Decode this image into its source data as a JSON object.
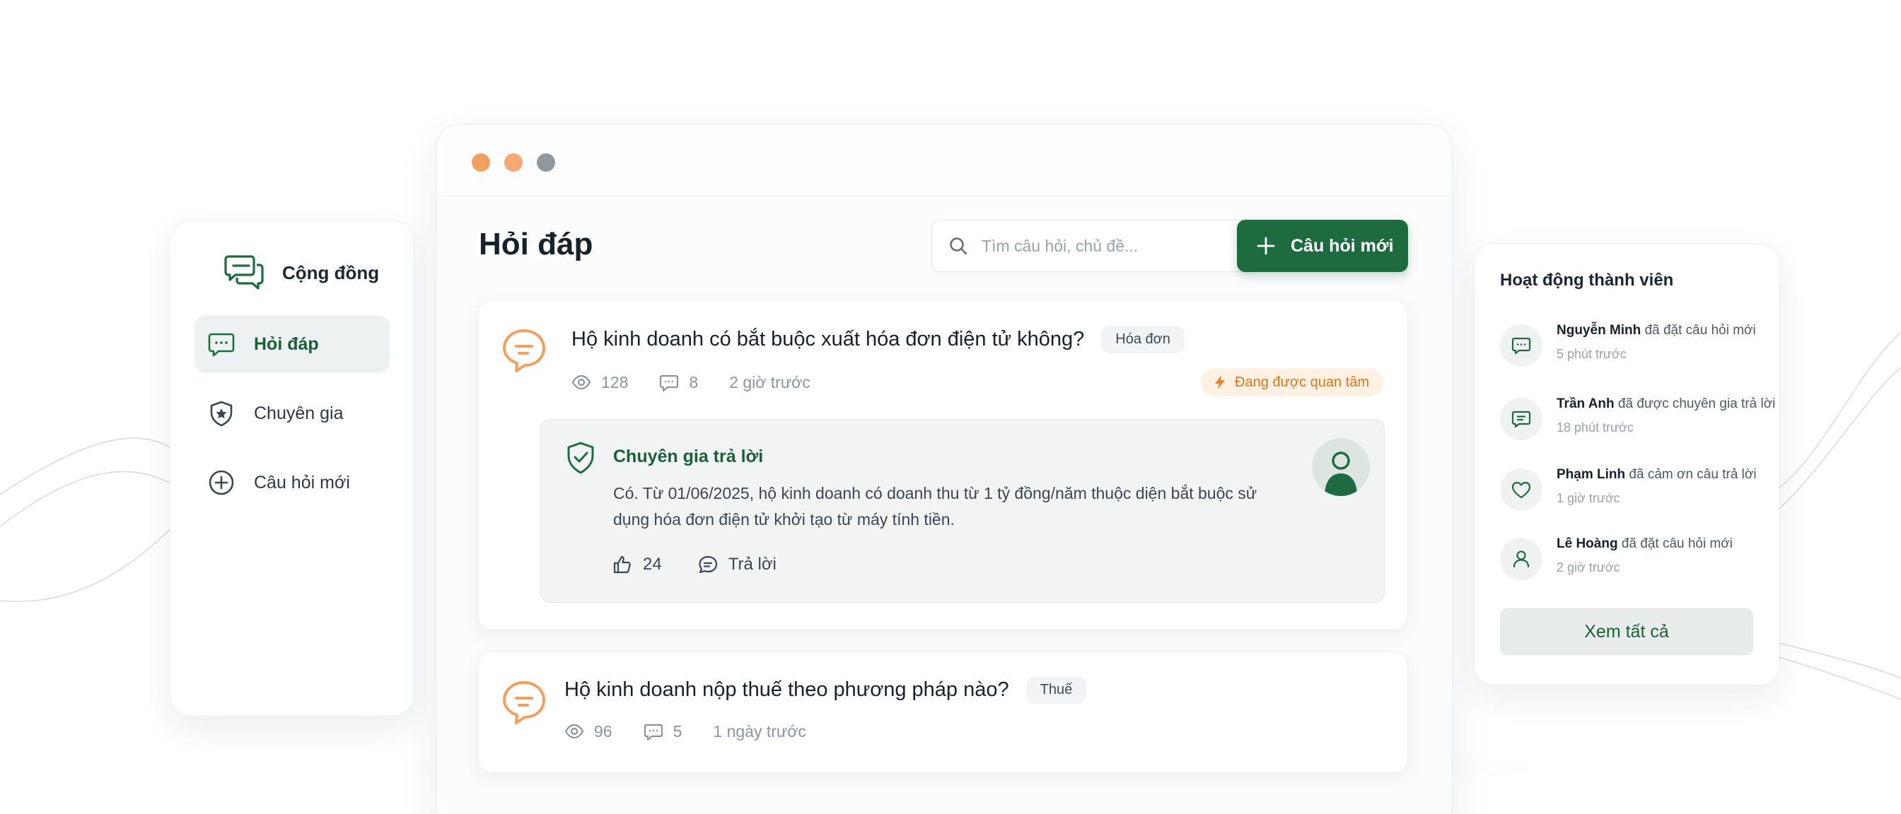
{
  "colors": {
    "brand_green": "#1e6b3f",
    "accent_orange": "#f2a061",
    "hot_orange": "#d9771f"
  },
  "sidebar": {
    "brand": {
      "name": "Cộng đồng",
      "icon": "chat-bubbles-icon"
    },
    "items": [
      {
        "label": "Hỏi đáp",
        "icon": "chat-dots-icon",
        "active": true
      },
      {
        "label": "Chuyên gia",
        "icon": "shield-star-icon",
        "active": false
      },
      {
        "label": "Câu hỏi mới",
        "icon": "plus-circle-icon",
        "active": false
      }
    ]
  },
  "main": {
    "title": "Hỏi đáp",
    "search": {
      "placeholder": "Tìm câu hỏi, chủ đề...",
      "icon": "search-icon"
    },
    "new_button": {
      "label": "Câu hỏi mới",
      "icon": "plus-icon"
    },
    "questions": [
      {
        "title": "Hộ kinh doanh có bắt buộc xuất hóa đơn điện tử không?",
        "tag": "Hóa đơn",
        "views": "128",
        "comments": "8",
        "time": "2 giờ trước",
        "badge": "Đang được quan tâm",
        "answer": {
          "label": "Chuyên gia trả lời",
          "text": "Có. Từ 01/06/2025, hộ kinh doanh có doanh thu từ 1 tỷ đồng/năm thuộc diện bắt buộc sử dụng hóa đơn điện tử khởi tạo từ máy tính tiền.",
          "likes": "24",
          "reply_label": "Trả lời"
        }
      },
      {
        "title": "Hộ kinh doanh nộp thuế theo phương pháp nào?",
        "tag": "Thuế",
        "views": "96",
        "comments": "5",
        "time": "1 ngày trước"
      }
    ]
  },
  "activity": {
    "title": "Hoạt động thành viên",
    "items": [
      {
        "name": "Nguyễn Minh",
        "action": "đã đặt câu hỏi mới",
        "time": "5 phút trước",
        "icon": "chat-dots-icon"
      },
      {
        "name": "Trần Anh",
        "action": "đã được chuyên gia trả lời",
        "time": "18 phút trước",
        "icon": "chat-lines-icon"
      },
      {
        "name": "Phạm Linh",
        "action": "đã cảm ơn câu trả lời",
        "time": "1 giờ trước",
        "icon": "heart-icon"
      },
      {
        "name": "Lê Hoàng",
        "action": "đã đặt câu hỏi mới",
        "time": "2 giờ trước",
        "icon": "user-icon"
      }
    ],
    "see_all": "Xem tất cả"
  }
}
